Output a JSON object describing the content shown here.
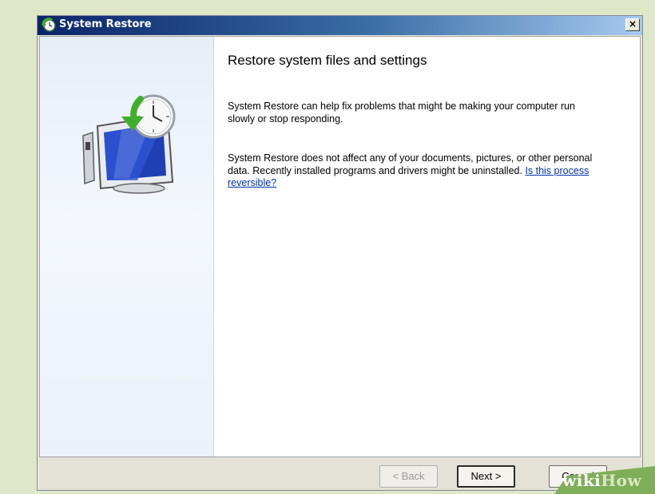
{
  "window": {
    "title": "System Restore",
    "close_label": "×"
  },
  "main": {
    "heading": "Restore system files and settings",
    "paragraph1": "System Restore can help fix problems that might be making your computer run slowly or stop responding.",
    "paragraph2": "System Restore does not affect any of your documents, pictures, or other personal data. Recently installed programs and drivers might be uninstalled.",
    "link": "Is this process reversible?"
  },
  "footer": {
    "back_label": "< Back",
    "next_label": "Next >",
    "cancel_label": "Cancel"
  },
  "watermark": {
    "part1": "wiki",
    "part2": "How"
  },
  "icons": {
    "title": "system-restore-icon",
    "hero": "monitor-clock-restore-icon",
    "close": "close-icon"
  }
}
